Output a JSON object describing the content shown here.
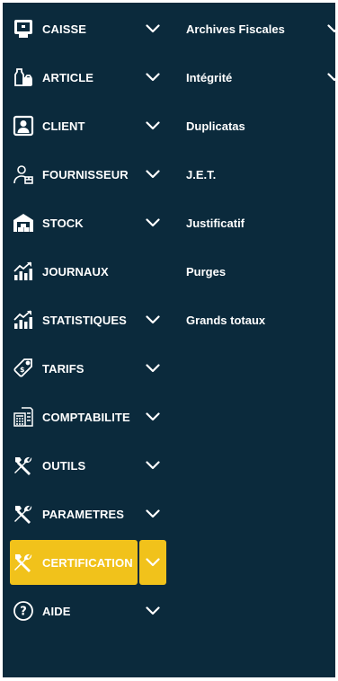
{
  "theme": {
    "background": "#0b2a3c",
    "accent": "#f1c21b",
    "text": "#ffffff"
  },
  "sidebar": {
    "items": [
      {
        "label": "CAISSE",
        "icon": "cash-register-icon",
        "has_chevron": true,
        "active": false
      },
      {
        "label": "ARTICLE",
        "icon": "products-icon",
        "has_chevron": true,
        "active": false
      },
      {
        "label": "CLIENT",
        "icon": "client-icon",
        "has_chevron": true,
        "active": false
      },
      {
        "label": "FOURNISSEUR",
        "icon": "supplier-icon",
        "has_chevron": true,
        "active": false
      },
      {
        "label": "STOCK",
        "icon": "warehouse-icon",
        "has_chevron": true,
        "active": false
      },
      {
        "label": "JOURNAUX",
        "icon": "chart-up-icon",
        "has_chevron": false,
        "active": false
      },
      {
        "label": "STATISTIQUES",
        "icon": "chart-up-icon",
        "has_chevron": true,
        "active": false
      },
      {
        "label": "TARIFS",
        "icon": "price-tag-icon",
        "has_chevron": true,
        "active": false
      },
      {
        "label": "COMPTABILITE",
        "icon": "accounting-icon",
        "has_chevron": true,
        "active": false
      },
      {
        "label": "OUTILS",
        "icon": "tools-icon",
        "has_chevron": true,
        "active": false
      },
      {
        "label": "PARAMETRES",
        "icon": "tools-icon",
        "has_chevron": true,
        "active": false
      },
      {
        "label": "CERTIFICATION",
        "icon": "tools-icon",
        "has_chevron": true,
        "active": true
      },
      {
        "label": "AIDE",
        "icon": "help-icon",
        "has_chevron": true,
        "active": false
      }
    ]
  },
  "submenu": {
    "items": [
      {
        "label": "Archives Fiscales",
        "has_chevron": true
      },
      {
        "label": "Intégrité",
        "has_chevron": true
      },
      {
        "label": "Duplicatas",
        "has_chevron": false
      },
      {
        "label": "J.E.T.",
        "has_chevron": false
      },
      {
        "label": "Justificatif",
        "has_chevron": false
      },
      {
        "label": "Purges",
        "has_chevron": false
      },
      {
        "label": "Grands totaux",
        "has_chevron": false
      }
    ]
  }
}
